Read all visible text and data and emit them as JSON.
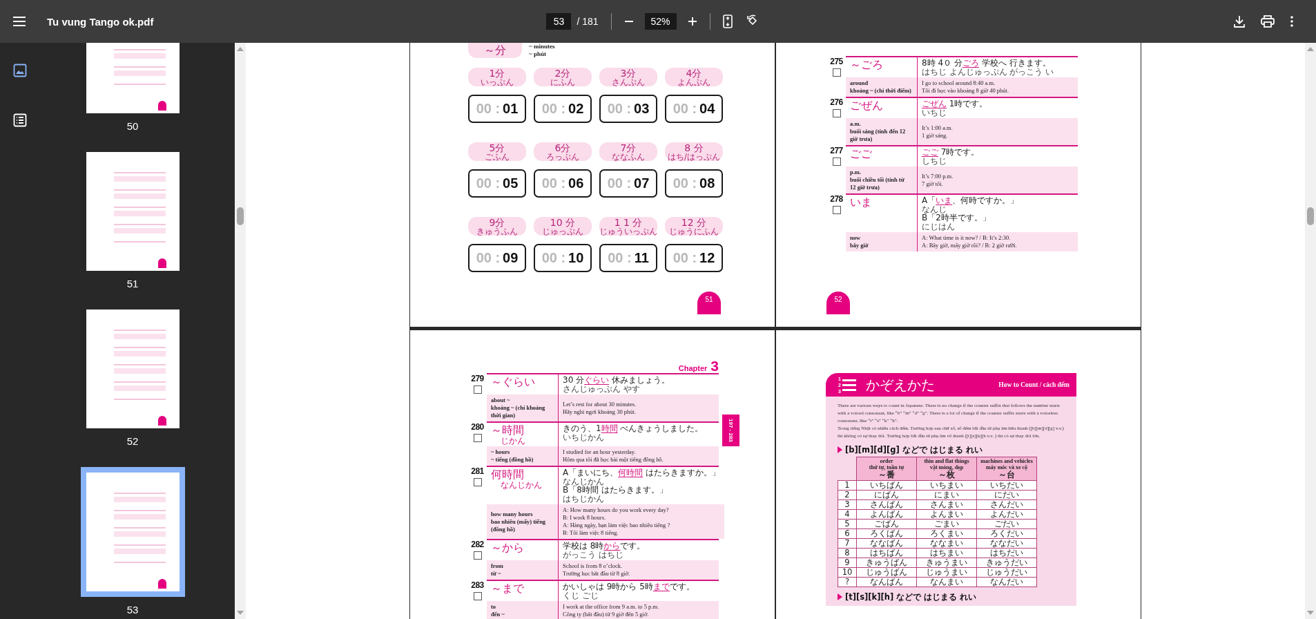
{
  "toolbar": {
    "title": "Tu vung Tango ok.pdf",
    "page": "53",
    "page_total": "/ 181",
    "zoom": "52%"
  },
  "sidebar": {
    "tabs": [
      {
        "kind": "thumbnails",
        "selected": true
      },
      {
        "kind": "outline",
        "selected": false
      }
    ],
    "thumbnails": [
      {
        "label": "50",
        "selected": false
      },
      {
        "label": "51",
        "selected": false
      },
      {
        "label": "52",
        "selected": false
      },
      {
        "label": "53",
        "selected": true
      }
    ]
  },
  "pages": [
    {
      "kind": "minutes",
      "number": "51",
      "header": {
        "label": "～分",
        "meanings": [
          "~ minutes",
          "~ phút"
        ]
      },
      "items": [
        {
          "label": "1分",
          "reading": "いっぷん",
          "prefix": "00 :",
          "minutes": "01"
        },
        {
          "label": "2分",
          "reading": "にふん",
          "prefix": "00 :",
          "minutes": "02"
        },
        {
          "label": "3分",
          "reading": "さんぷん",
          "prefix": "00 :",
          "minutes": "03"
        },
        {
          "label": "4分",
          "reading": "よんぷん",
          "prefix": "00 :",
          "minutes": "04"
        },
        {
          "label": "5分",
          "reading": "ごふん",
          "prefix": "00 :",
          "minutes": "05"
        },
        {
          "label": "6分",
          "reading": "ろっぷん",
          "prefix": "00 :",
          "minutes": "06"
        },
        {
          "label": "7分",
          "reading": "ななふん",
          "prefix": "00 :",
          "minutes": "07"
        },
        {
          "label": "8 分",
          "reading": "はち/はっぷん",
          "prefix": "00 :",
          "minutes": "08"
        },
        {
          "label": "9分",
          "reading": "きゅうふん",
          "prefix": "00 :",
          "minutes": "09"
        },
        {
          "label": "10 分",
          "reading": "じゅっぷん",
          "prefix": "00 :",
          "minutes": "10"
        },
        {
          "label": "1 1 分",
          "reading": "じゅういっぷん",
          "prefix": "00 :",
          "minutes": "11"
        },
        {
          "label": "12 分",
          "reading": "じゅうにふん",
          "prefix": "00 :",
          "minutes": "12"
        }
      ]
    },
    {
      "kind": "vocab",
      "number": "52",
      "entries": [
        {
          "number": "275",
          "checked": false,
          "term": "～ごろ",
          "examples": [
            {
              "parts": [
                {
                  "text": "8時 4０ 分",
                  "highlight": false
                },
                {
                  "text": "ごろ",
                  "highlight": true
                },
                {
                  "text": " 学校へ 行きます。",
                  "highlight": false
                }
              ],
              "ruby": "はちじ よんじゅっぷん がっこう い"
            }
          ],
          "meanings": [
            "around",
            "khoảng ~ (chỉ thời điểm)"
          ],
          "translations": [
            "I go to school around 8:40 a.m.",
            "Tôi đi học vào khoảng 8 giờ 40 phút."
          ]
        },
        {
          "number": "276",
          "checked": false,
          "term": "ごぜん",
          "examples": [
            {
              "parts": [
                {
                  "text": "ごぜん",
                  "highlight": true
                },
                {
                  "text": " 1時です。",
                  "highlight": false
                }
              ],
              "ruby": "いちじ"
            }
          ],
          "meanings": [
            "a.m.",
            "buổi sáng (tính đến 12",
            "giờ trưa)"
          ],
          "translations": [
            "It’s 1:00 a.m.",
            "1 giờ sáng."
          ]
        },
        {
          "number": "277",
          "checked": false,
          "term": "ごご",
          "examples": [
            {
              "parts": [
                {
                  "text": "ごご",
                  "highlight": true
                },
                {
                  "text": " 7時です。",
                  "highlight": false
                }
              ],
              "ruby": "しちじ"
            }
          ],
          "meanings": [
            "p.m.",
            "buổi chiều tối (tính từ",
            "12 giờ trưa)"
          ],
          "translations": [
            "It’s 7:00 p.m.",
            "7 giờ tối."
          ]
        },
        {
          "number": "278",
          "checked": false,
          "term": "いま",
          "examples": [
            {
              "parts": [
                {
                  "text": "A「",
                  "highlight": false
                },
                {
                  "text": "いま",
                  "highlight": true
                },
                {
                  "text": "、何時ですか。」",
                  "highlight": false
                }
              ],
              "ruby": "なんじ"
            },
            {
              "parts": [
                {
                  "text": "B「2時半です。」",
                  "highlight": false
                }
              ],
              "ruby": "にじはん"
            }
          ],
          "meanings": [
            "now",
            "bây giờ"
          ],
          "translations": [
            "A: What time is it now? / B: It’s 2:30.",
            "A: Bây giờ, mấy giờ rồi? / B: 2 giờ rưỡi."
          ]
        }
      ]
    },
    {
      "kind": "vocab",
      "chapter": {
        "label": "Chapter",
        "number": "3"
      },
      "side_tab": "197 - 283",
      "entries": [
        {
          "number": "279",
          "checked": false,
          "term": "～ぐらい",
          "examples": [
            {
              "parts": [
                {
                  "text": "30 分",
                  "highlight": false
                },
                {
                  "text": "ぐらい",
                  "highlight": true
                },
                {
                  "text": " 休みましょう。",
                  "highlight": false
                }
              ],
              "ruby": "さんじゅっぷん やす"
            }
          ],
          "meanings": [
            "about ~",
            "khoảng ~ (chỉ khoảng",
            "thời gian)"
          ],
          "translations": [
            "Let’s rest for about 30 minutes.",
            "Hãy nghỉ ngơi khoảng 30 phút."
          ]
        },
        {
          "number": "280",
          "checked": false,
          "term": "～時間",
          "term_reading": "じかん",
          "examples": [
            {
              "parts": [
                {
                  "text": "きのう、1",
                  "highlight": false
                },
                {
                  "text": "時間",
                  "highlight": true
                },
                {
                  "text": " べんきょうしました。",
                  "highlight": false
                }
              ],
              "ruby": "いちじかん"
            }
          ],
          "meanings": [
            "~ hours",
            "~ tiếng (đồng hồ)"
          ],
          "translations": [
            "I studied for an hour yesterday.",
            "Hôm qua tôi đã học bài một tiếng đồng hồ."
          ]
        },
        {
          "number": "281",
          "checked": false,
          "term": "何時間",
          "term_reading": "なんじかん",
          "examples": [
            {
              "parts": [
                {
                  "text": "A「まいにち、",
                  "highlight": false
                },
                {
                  "text": "何時間",
                  "highlight": true
                },
                {
                  "text": " はたらきますか。」",
                  "highlight": false
                }
              ],
              "ruby": "なんじかん"
            },
            {
              "parts": [
                {
                  "text": "B「8時間 はたらきます。」",
                  "highlight": false
                }
              ],
              "ruby": "はちじかん"
            }
          ],
          "meanings": [
            "how many hours",
            "bao nhiêu (mấy)  tiếng",
            "(đồng hồ)"
          ],
          "translations": [
            "A: How many hours do you work every day?",
            "B: I work 8 hours.",
            "A: Hàng ngày, bạn làm việc bao nhiêu tiếng ?",
            "B: Tôi làm việc 8 tiếng."
          ]
        },
        {
          "number": "282",
          "checked": false,
          "term": "～から",
          "examples": [
            {
              "parts": [
                {
                  "text": "学校は 8時",
                  "highlight": false
                },
                {
                  "text": "から",
                  "highlight": true
                },
                {
                  "text": "です。",
                  "highlight": false
                }
              ],
              "ruby": "がっこう はちじ"
            }
          ],
          "meanings": [
            "from",
            "từ ~"
          ],
          "translations": [
            "School is from 8 o’clock.",
            "Trường học bắt đầu từ 8 giờ."
          ]
        },
        {
          "number": "283",
          "checked": false,
          "term": "～まで",
          "examples": [
            {
              "parts": [
                {
                  "text": "かいしゃは 9時から 5時",
                  "highlight": false
                },
                {
                  "text": "まで",
                  "highlight": true
                },
                {
                  "text": "です。",
                  "highlight": false
                }
              ],
              "ruby": "くじ ごじ"
            }
          ],
          "meanings": [
            "to",
            "đến ~"
          ],
          "translations": [
            "I work at the office from 9 a.m. to 5 p.m.",
            "Công ty (bắt đầu) từ 9 giờ đến 5 giờ."
          ]
        }
      ]
    },
    {
      "kind": "counting",
      "icon_digits": [
        "1",
        "2",
        "3"
      ],
      "title": "かぞえかた",
      "subtitle": "How to Count / cách đếm",
      "paragraphs": [
        "There are various ways to count in Japanese. There is no change if the counter suffix that follows the number starts with a voiced consonant, like “b” “m” “d” “g”. There is a lot of change if the counter suffix starts with a voiceless consonant, like “t” “s” “k” “h”.",
        "Trong tiếng Nhật có nhiều cách đếm. Trường hợp sau chữ số, số đếm bắt đầu từ phụ âm hữu thanh ([b][m][d][g] v.v.)  thì không có sự thay đổi. Trường hợp bắt đầu từ phụ âm vô thanh ([t][s][k][h v.v. ) thì có sự thay đổi lớn."
      ],
      "sections": [
        {
          "heading": "[b][m][d][g] などで はじまる れい",
          "table": {
            "columns": [
              {
                "lines": [
                  "order",
                  "thứ tự, tuần tự"
                ],
                "counter": "～番"
              },
              {
                "lines": [
                  "thin and flat things",
                  "vật mỏng, dẹp"
                ],
                "counter": "～枚"
              },
              {
                "lines": [
                  "machines and vehicles",
                  "máy móc và xe cộ"
                ],
                "counter": "～台"
              }
            ],
            "rows": [
              {
                "label": "1",
                "cells": [
                  "いちばん",
                  "いちまい",
                  "いちだい"
                ]
              },
              {
                "label": "2",
                "cells": [
                  "にばん",
                  "にまい",
                  "にだい"
                ]
              },
              {
                "label": "3",
                "cells": [
                  "さんばん",
                  "さんまい",
                  "さんだい"
                ]
              },
              {
                "label": "4",
                "cells": [
                  "よんばん",
                  "よんまい",
                  "よんだい"
                ]
              },
              {
                "label": "5",
                "cells": [
                  "ごばん",
                  "ごまい",
                  "ごだい"
                ]
              },
              {
                "label": "6",
                "cells": [
                  "ろくばん",
                  "ろくまい",
                  "ろくだい"
                ]
              },
              {
                "label": "7",
                "cells": [
                  "ななばん",
                  "ななまい",
                  "ななだい"
                ]
              },
              {
                "label": "8",
                "cells": [
                  "はちばん",
                  "はちまい",
                  "はちだい"
                ]
              },
              {
                "label": "9",
                "cells": [
                  "きゅうばん",
                  "きゅうまい",
                  "きゅうだい"
                ]
              },
              {
                "label": "10",
                "cells": [
                  "じゅうばん",
                  "じゅうまい",
                  "じゅうだい"
                ]
              },
              {
                "label": "?",
                "cells": [
                  "なんばん",
                  "なんまい",
                  "なんだい"
                ]
              }
            ]
          }
        },
        {
          "heading": "[t][s][k][h] などで はじまる れい"
        }
      ]
    }
  ]
}
